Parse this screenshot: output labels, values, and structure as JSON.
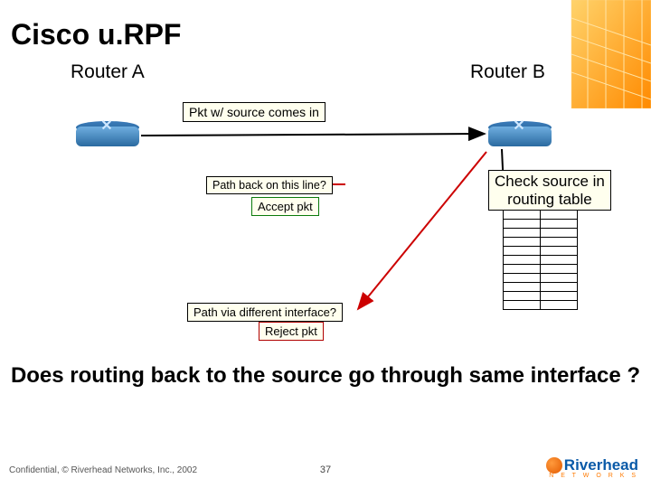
{
  "title": "Cisco u.RPF",
  "router_a": "Router A",
  "router_b": "Router B",
  "pkt_source": "Pkt w/ source comes in",
  "path_back": "Path back on this line?",
  "accept": "Accept pkt",
  "check_src_l1": "Check source in",
  "check_src_l2": "routing table",
  "path_diff": "Path via different interface?",
  "reject": "Reject pkt",
  "question": "Does routing back to the source go through same interface ?",
  "footer": "Confidential, © Riverhead Networks, Inc., 2002",
  "page": "37",
  "logo_text": "Riverhead",
  "logo_sub": "N E T W O R K S",
  "routing_rows": 11,
  "colors": {
    "accent_orange": "#ff7a00",
    "accent_blue": "#0a5aa8",
    "box_bg": "#ffffee"
  }
}
